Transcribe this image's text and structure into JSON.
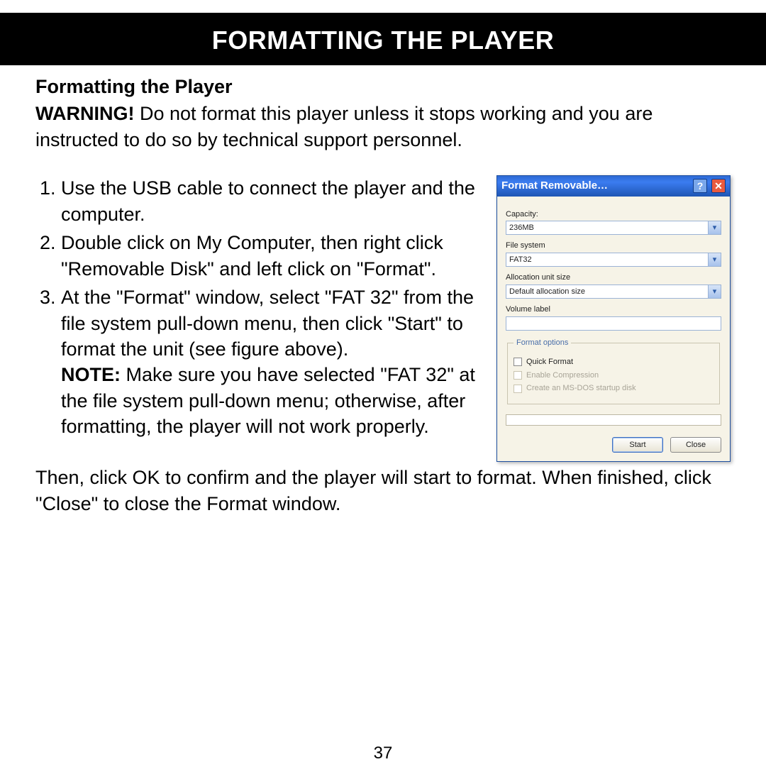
{
  "page_title": "FORMATTING THE PLAYER",
  "subheading": "Formatting the Player",
  "warning_label": "WARNING!",
  "warning_text": " Do not format this player unless it stops working and you are instructed to do so by technical support personnel.",
  "steps": {
    "s1": "Use the USB cable to connect the player and the computer.",
    "s2": "Double click on My Computer, then right click \"Removable Disk\" and left click on \"Format\".",
    "s3a": "At the \"Format\" window, select \"FAT 32\" from the file system pull-down menu, then click \"Start\" to format the unit (see figure above).",
    "note_label": "NOTE:",
    "s3b": " Make sure you have selected \"FAT 32\" at the file system pull-down menu; otherwise, after formatting, the player will not work properly.",
    "s3c": "Then, click OK to confirm and the player will start to format. When finished, click \"Close\" to close the Format window."
  },
  "page_number": "37",
  "dialog": {
    "title": "Format Removable…",
    "labels": {
      "capacity": "Capacity:",
      "file_system": "File system",
      "alloc": "Allocation unit size",
      "volume": "Volume label",
      "options_legend": "Format options",
      "quick_format": "Quick Format",
      "enable_compression": "Enable Compression",
      "msdos": "Create an MS-DOS startup disk"
    },
    "values": {
      "capacity": "236MB",
      "file_system": "FAT32",
      "alloc": "Default allocation size",
      "volume": ""
    },
    "buttons": {
      "start": "Start",
      "close": "Close"
    }
  }
}
